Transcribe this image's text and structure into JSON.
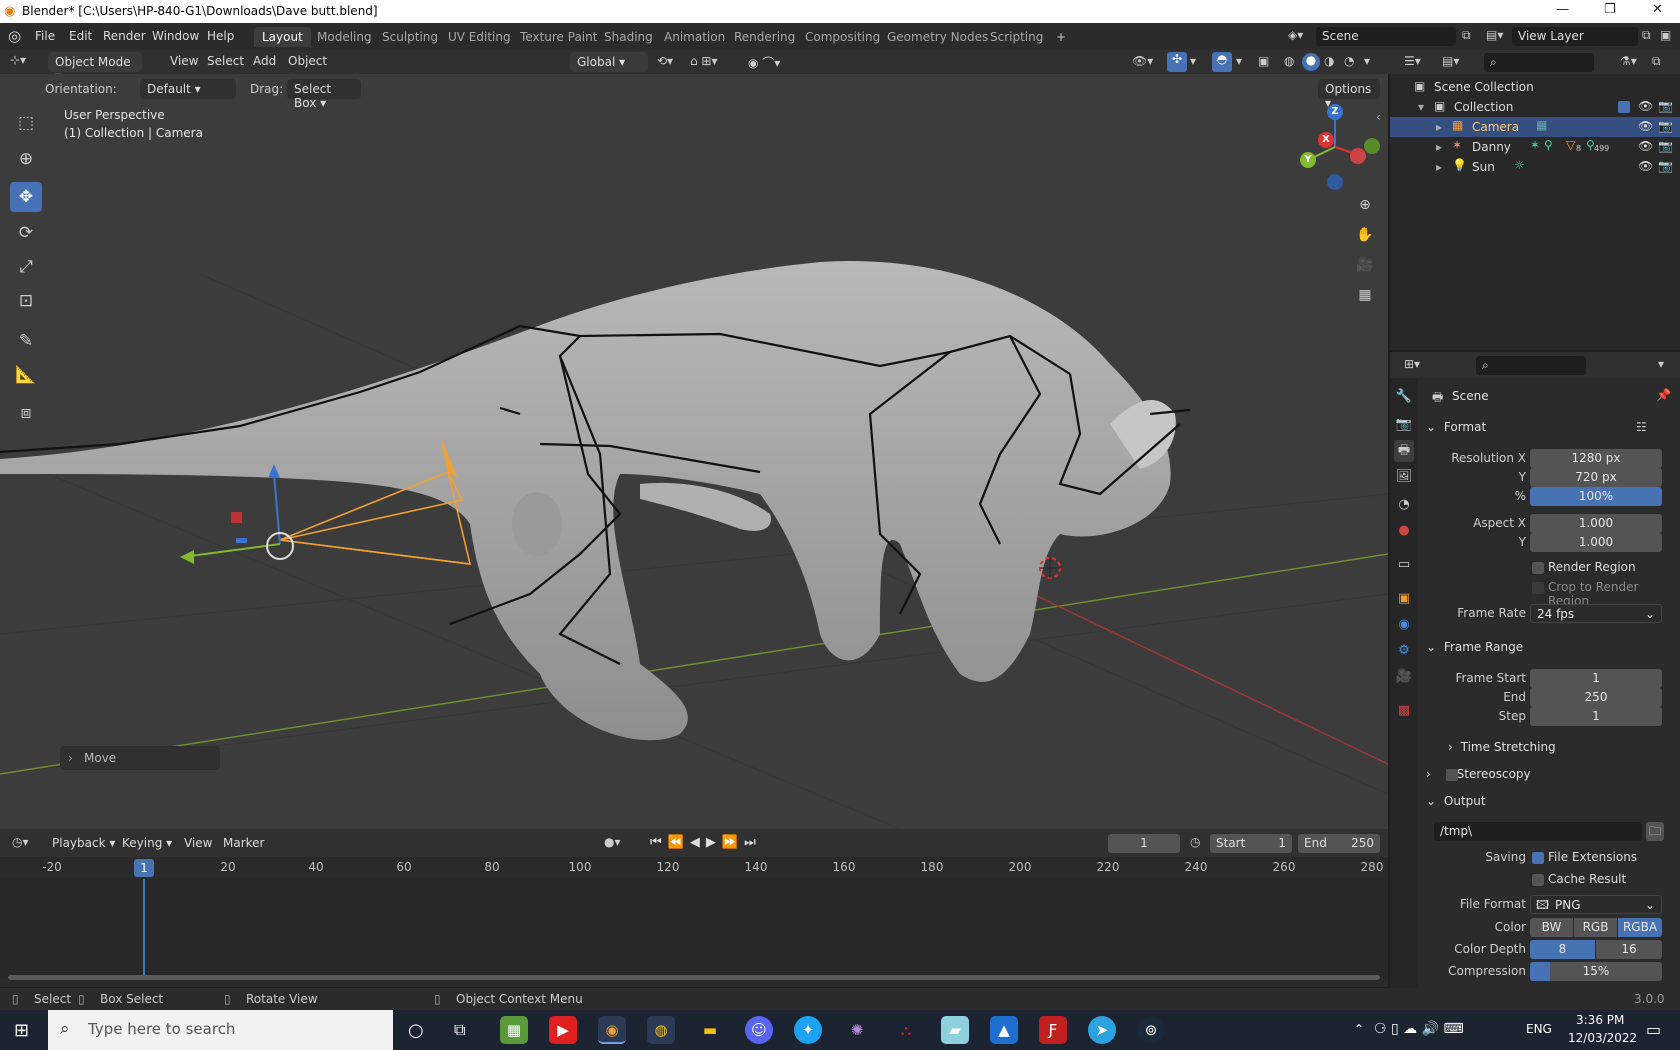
{
  "window": {
    "title": "Blender* [C:\\Users\\HP-840-G1\\Downloads\\Dave butt.blend]"
  },
  "menu": [
    "File",
    "Edit",
    "Render",
    "Window",
    "Help"
  ],
  "workspaces": [
    "Layout",
    "Modeling",
    "Sculpting",
    "UV Editing",
    "Texture Paint",
    "Shading",
    "Animation",
    "Rendering",
    "Compositing",
    "Geometry Nodes",
    "Scripting"
  ],
  "scene_field": "Scene",
  "viewlayer_field": "View Layer",
  "header3d": {
    "mode": "Object Mode",
    "menus": [
      "View",
      "Select",
      "Add",
      "Object"
    ],
    "transform": "Global",
    "orientation_label": "Orientation:",
    "orientation_value": "Default",
    "drag_label": "Drag:",
    "drag_value": "Select Box",
    "options": "Options"
  },
  "viewport": {
    "perspective": "User Perspective",
    "collection_info": "(1) Collection | Camera",
    "last_op": "Move",
    "gizmo": {
      "z": "Z",
      "y": "Y",
      "x": "X"
    }
  },
  "timeline": {
    "menus": [
      "Playback",
      "Keying",
      "View",
      "Marker"
    ],
    "current_frame": "1",
    "start_label": "Start",
    "start": "1",
    "end_label": "End",
    "end": "250",
    "ticks": [
      "-20",
      "20",
      "40",
      "60",
      "80",
      "100",
      "120",
      "140",
      "160",
      "180",
      "200",
      "220",
      "240",
      "260",
      "280"
    ],
    "playhead": "1"
  },
  "statusbar": {
    "items": [
      "Select",
      "Box Select",
      "Rotate View",
      "Object Context Menu"
    ],
    "version": "3.0.0"
  },
  "outliner": {
    "scene_collection": "Scene Collection",
    "collection": "Collection",
    "objects": [
      "Camera",
      "Danny",
      "Sun"
    ],
    "danny_badges": [
      "8",
      "499"
    ]
  },
  "properties": {
    "context": "Scene",
    "format": {
      "title": "Format",
      "res_x_label": "Resolution X",
      "res_x": "1280 px",
      "res_y_label": "Y",
      "res_y": "720 px",
      "pct_label": "%",
      "pct": "100%",
      "aspect_x_label": "Aspect X",
      "aspect_x": "1.000",
      "aspect_y_label": "Y",
      "aspect_y": "1.000",
      "render_region": "Render Region",
      "crop": "Crop to Render Region",
      "frame_rate_label": "Frame Rate",
      "frame_rate": "24 fps"
    },
    "frame_range": {
      "title": "Frame Range",
      "start_label": "Frame Start",
      "start": "1",
      "end_label": "End",
      "end": "250",
      "step_label": "Step",
      "step": "1",
      "time_stretching": "Time Stretching"
    },
    "stereoscopy": "Stereoscopy",
    "output": {
      "title": "Output",
      "path": "/tmp\\",
      "saving_label": "Saving",
      "file_ext": "File Extensions",
      "cache": "Cache Result",
      "file_format_label": "File Format",
      "file_format": "PNG",
      "color_label": "Color",
      "color_opts": [
        "BW",
        "RGB",
        "RGBA"
      ],
      "depth_label": "Color Depth",
      "depth_opts": [
        "8",
        "16"
      ],
      "comp_label": "Compression",
      "comp": "15%"
    }
  },
  "taskbar": {
    "search": "Type here to search",
    "time": "3:36 PM",
    "date": "12/03/2022",
    "lang": "ENG"
  },
  "colors": {
    "accent": "#4772b3",
    "selection": "#344f80",
    "camera": "#f0a030"
  }
}
